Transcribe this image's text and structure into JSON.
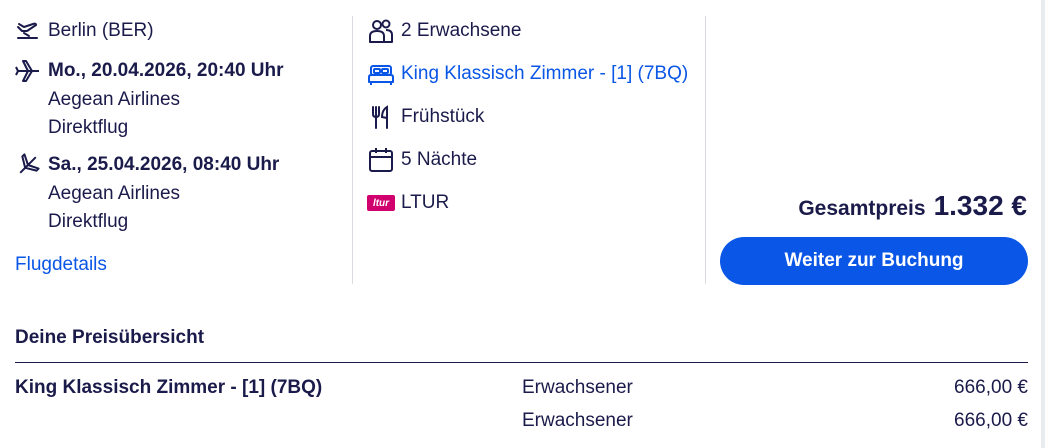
{
  "flight": {
    "origin": "Berlin (BER)",
    "outbound": {
      "datetime": "Mo., 20.04.2026, 20:40 Uhr",
      "airline": "Aegean Airlines",
      "stops": "Direktflug"
    },
    "return": {
      "datetime": "Sa., 25.04.2026, 08:40 Uhr",
      "airline": "Aegean Airlines",
      "stops": "Direktflug"
    },
    "details_link": "Flugdetails"
  },
  "booking": {
    "travellers": "2 Erwachsene",
    "room": "King Klassisch Zimmer - [1] (7BQ)",
    "board": "Frühstück",
    "nights": "5 Nächte",
    "provider": "LTUR",
    "provider_logo_text": "ltur"
  },
  "pricing": {
    "total_label": "Gesamtpreis",
    "total_value": "1.332 €",
    "cta_label": "Weiter zur Buchung"
  },
  "price_overview": {
    "title": "Deine Preisübersicht",
    "rows": [
      {
        "name": "King Klassisch Zimmer - [1] (7BQ)",
        "type": "Erwachsener",
        "amount": "666,00 €"
      },
      {
        "name": "",
        "type": "Erwachsener",
        "amount": "666,00 €"
      }
    ]
  },
  "colors": {
    "text": "#1b1b4b",
    "accent": "#0a56e6",
    "ltur": "#d0006f"
  }
}
